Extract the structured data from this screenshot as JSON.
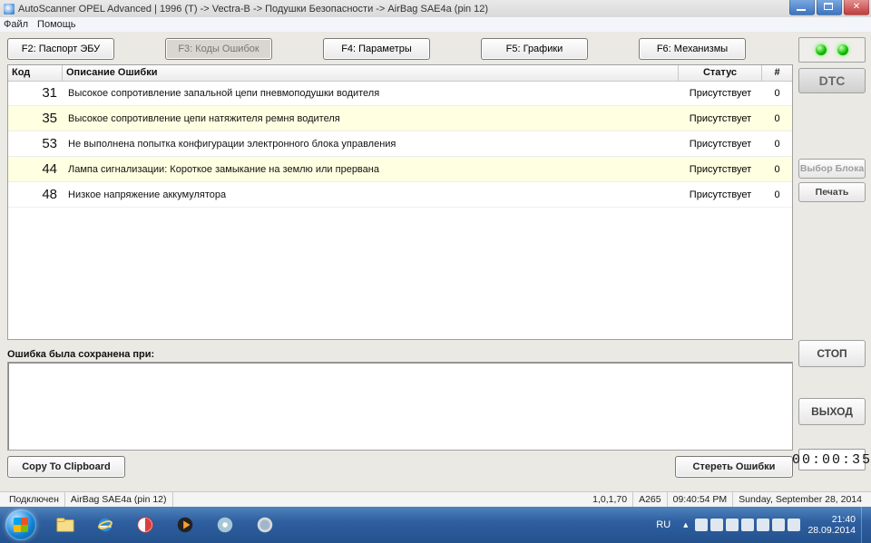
{
  "window": {
    "title": "AutoScanner OPEL Advanced | 1996 (T) -> Vectra-B -> Подушки Безопасности -> AirBag SAE4a (pin 12)"
  },
  "menu": {
    "file": "Файл",
    "help": "Помощь"
  },
  "toolbar": {
    "f2": "F2: Паспорт ЭБУ",
    "f3": "F3: Коды Ошибок",
    "f4": "F4: Параметры",
    "f5": "F5: Графики",
    "f6": "F6: Механизмы"
  },
  "table": {
    "head": {
      "code": "Код",
      "desc": "Описание Ошибки",
      "status": "Статус",
      "cnt": "#"
    },
    "rows": [
      {
        "code": "31",
        "desc": "Высокое сопротивление запальной цепи пневмоподушки водителя",
        "status": "Присутствует",
        "cnt": "0",
        "hi": false
      },
      {
        "code": "35",
        "desc": "Высокое сопротивление цепи натяжителя ремня водителя",
        "status": "Присутствует",
        "cnt": "0",
        "hi": true
      },
      {
        "code": "53",
        "desc": "Не выполнена попытка конфигурации электронного блока управления",
        "status": "Присутствует",
        "cnt": "0",
        "hi": false
      },
      {
        "code": "44",
        "desc": "Лампа сигнализации:  Короткое замыкание на землю или прервана",
        "status": "Присутствует",
        "cnt": "0",
        "hi": true
      },
      {
        "code": "48",
        "desc": "Низкое напряжение аккумулятора",
        "status": "Присутствует",
        "cnt": "0",
        "hi": false
      }
    ]
  },
  "saved_label": "Ошибка была сохранена при:",
  "buttons": {
    "copy": "Copy To Clipboard",
    "clear": "Стереть Ошибки"
  },
  "sidebar": {
    "dtc": "DTC",
    "select_block": "Выбор Блока",
    "print": "Печать",
    "stop": "СТОП",
    "exit": "ВЫХОД",
    "counter": "00:00:35"
  },
  "statusbar": {
    "conn": "Подключен",
    "ecu": "AirBag SAE4a (pin 12)",
    "ver": "1,0,1,70",
    "a": "A265",
    "time": "09:40:54 PM",
    "date": "Sunday, September 28, 2014"
  },
  "taskbar": {
    "lang": "RU",
    "clock_time": "21:40",
    "clock_date": "28.09.2014"
  }
}
